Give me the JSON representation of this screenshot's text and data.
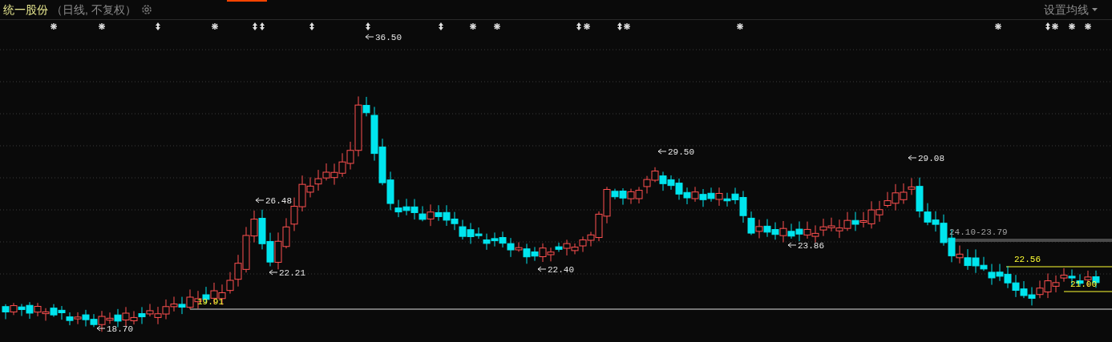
{
  "header": {
    "stock_name": "统一股份",
    "period": "（日线, 不复权）",
    "ma_button": "设置均线"
  },
  "markers": [
    {
      "kind": "star"
    },
    {
      "kind": "star"
    },
    {
      "kind": "arrow"
    },
    {
      "kind": "star"
    },
    {
      "kind": "arrow"
    },
    {
      "kind": "arrow"
    },
    {
      "kind": "arrow"
    },
    {
      "kind": "arrow"
    },
    {
      "kind": "arrow"
    },
    {
      "kind": "star"
    },
    {
      "kind": "star"
    },
    {
      "kind": "arrow"
    },
    {
      "kind": "star"
    },
    {
      "kind": "arrow"
    },
    {
      "kind": "star"
    },
    {
      "kind": "star"
    },
    {
      "kind": "star"
    },
    {
      "kind": "arrow"
    },
    {
      "kind": "star"
    },
    {
      "kind": "star"
    },
    {
      "kind": "star"
    }
  ],
  "price_labels": [
    {
      "text": "36.50",
      "kind": "extreme"
    },
    {
      "text": "26.48",
      "kind": "extreme"
    },
    {
      "text": "22.21",
      "kind": "extreme"
    },
    {
      "text": "19.91",
      "kind": "level"
    },
    {
      "text": "18.70",
      "kind": "extreme"
    },
    {
      "text": "22.40",
      "kind": "extreme"
    },
    {
      "text": "29.50",
      "kind": "extreme"
    },
    {
      "text": "23.86",
      "kind": "extreme"
    },
    {
      "text": "29.08",
      "kind": "extreme"
    },
    {
      "text": "24.10-23.79",
      "kind": "range"
    },
    {
      "text": "22.56",
      "kind": "level"
    },
    {
      "text": "21.00",
      "kind": "level"
    }
  ]
}
